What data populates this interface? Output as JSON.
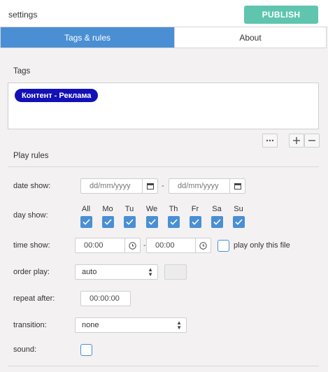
{
  "app": {
    "title": "settings",
    "publish_label": "PUBLISH"
  },
  "tabs": [
    {
      "label": "Tags & rules",
      "active": true
    },
    {
      "label": "About",
      "active": false
    }
  ],
  "tags": {
    "section_label": "Tags",
    "items": [
      "Контент - Реклама"
    ],
    "tag_color": "#1310b8",
    "buttons": {
      "more": "more-icon",
      "add": "plus-icon",
      "remove": "minus-icon"
    }
  },
  "play_rules": {
    "section_label": "Play rules",
    "date_show": {
      "label": "date show:",
      "from_placeholder": "dd/mm/yyyy",
      "to_placeholder": "dd/mm/yyyy",
      "separator": "-"
    },
    "day_show": {
      "label": "day show:",
      "days": [
        {
          "label": "All",
          "checked": true
        },
        {
          "label": "Mo",
          "checked": true
        },
        {
          "label": "Tu",
          "checked": true
        },
        {
          "label": "We",
          "checked": true
        },
        {
          "label": "Th",
          "checked": true
        },
        {
          "label": "Fr",
          "checked": true
        },
        {
          "label": "Sa",
          "checked": true
        },
        {
          "label": "Su",
          "checked": true
        }
      ]
    },
    "time_show": {
      "label": "time show:",
      "from": "00:00",
      "to": "00:00",
      "separator": "-",
      "only_this_file_label": "play only this file",
      "only_this_file_checked": false
    },
    "order_play": {
      "label": "order play:",
      "value": "auto"
    },
    "repeat_after": {
      "label": "repeat after:",
      "value": "00:00:00"
    },
    "transition": {
      "label": "transition:",
      "value": "none"
    },
    "sound": {
      "label": "sound:",
      "checked": false
    }
  },
  "colors": {
    "accent": "#4a8fd3",
    "publish": "#5fc5ae",
    "tag": "#1310b8",
    "background": "#f3f1f2"
  }
}
